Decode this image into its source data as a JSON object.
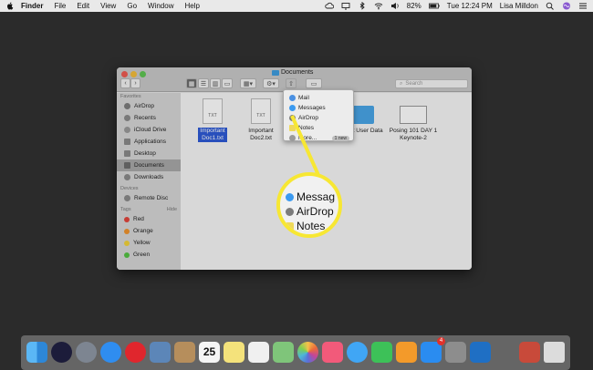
{
  "menubar": {
    "app": "Finder",
    "items": [
      "File",
      "Edit",
      "View",
      "Go",
      "Window",
      "Help"
    ],
    "battery": "82%",
    "clock": "Tue 12:24 PM",
    "user": "Lisa Milldon"
  },
  "window": {
    "title": "Documents",
    "search_placeholder": "Search"
  },
  "sidebar": {
    "favorites_header": "Favorites",
    "favorites": [
      "AirDrop",
      "Recents",
      "iCloud Drive",
      "Applications",
      "Desktop",
      "Documents",
      "Downloads"
    ],
    "devices_header": "Devices",
    "devices": [
      "Remote Disc"
    ],
    "tags_header": "Tags",
    "tags_hide": "Hide",
    "tags": [
      "Red",
      "Orange",
      "Yellow",
      "Green"
    ],
    "tag_colors": [
      "#e2453c",
      "#f0932e",
      "#f3d33a",
      "#55c244"
    ]
  },
  "files": [
    {
      "name": "Important Doc1.txt",
      "label": "TXT"
    },
    {
      "name": "Important Doc2.txt",
      "label": "TXT"
    },
    {
      "name": "osoft User Data",
      "label": ""
    },
    {
      "name": "Posing 101 DAY 1 Keynote-2",
      "label": ""
    }
  ],
  "share_menu": {
    "items": [
      "Mail",
      "Messages",
      "AirDrop",
      "Notes",
      "More..."
    ],
    "more_badge": "1 new"
  },
  "magnifier": {
    "items": [
      "Messag",
      "AirDrop",
      "Notes"
    ]
  },
  "dock": {
    "calendar_day": "25",
    "appstore_badge": "4"
  },
  "colors": {
    "highlight_yellow": "#f7e733",
    "selection_blue": "#2e5bd6"
  }
}
